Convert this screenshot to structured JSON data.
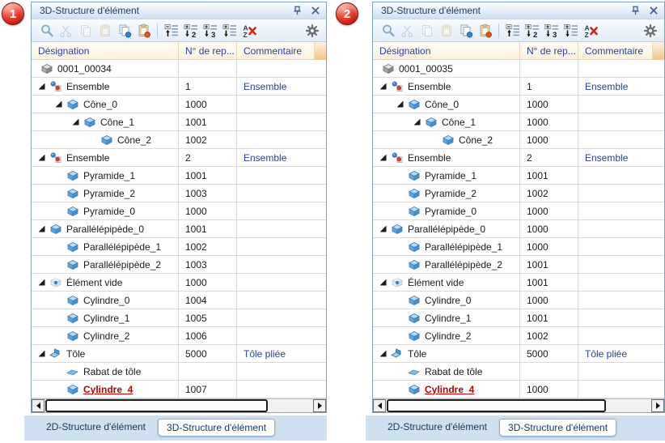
{
  "colors": {
    "panel_border": "#7aa3d0",
    "titlebar_text": "#1d3a5f",
    "header_text": "#2b3f9e",
    "comment_text": "#2b3f9e",
    "row_text": "#1a1a1a",
    "alert_red": "#c00000",
    "badge_red": "#cf1d12",
    "tab_strip": "#cfe0f0",
    "tab_text": "#17365d",
    "header_filler": "#f6c489"
  },
  "toolbar": {
    "icons": [
      {
        "name": "search",
        "disabled": false
      },
      {
        "name": "cut",
        "disabled": true
      },
      {
        "name": "copy",
        "disabled": true
      },
      {
        "name": "paste",
        "disabled": true
      },
      {
        "name": "copy-with-id",
        "disabled": false
      },
      {
        "name": "paste-with-id",
        "disabled": false
      },
      {
        "name": "separator"
      },
      {
        "name": "collapse-structure",
        "disabled": false
      },
      {
        "name": "expand-to-level-2",
        "disabled": false
      },
      {
        "name": "expand-to-level-3",
        "disabled": false
      },
      {
        "name": "expand-all-levels",
        "disabled": false
      },
      {
        "name": "remove-sorting",
        "disabled": false
      }
    ],
    "settings_icon": "settings-gear"
  },
  "panels": [
    {
      "badge": "1",
      "title": "3D-Structure d'élément",
      "columns": [
        "Désignation",
        "N° de rep...",
        "Commentaire"
      ],
      "rows": [
        {
          "name": "0001_00034",
          "num": "",
          "comment": "",
          "depth": 0,
          "expander": false,
          "icon": "root-part"
        },
        {
          "name": "Ensemble",
          "num": "1",
          "comment": "Ensemble",
          "depth": 1,
          "expander": true,
          "icon": "assembly"
        },
        {
          "name": "Cône_0",
          "num": "1000",
          "comment": "",
          "depth": 2,
          "expander": true,
          "icon": "solid"
        },
        {
          "name": "Cône_1",
          "num": "1001",
          "comment": "",
          "depth": 3,
          "expander": true,
          "icon": "solid"
        },
        {
          "name": "Cône_2",
          "num": "1002",
          "comment": "",
          "depth": 4,
          "expander": false,
          "icon": "solid"
        },
        {
          "name": "Ensemble",
          "num": "2",
          "comment": "Ensemble",
          "depth": 1,
          "expander": true,
          "icon": "assembly"
        },
        {
          "name": "Pyramide_1",
          "num": "1001",
          "comment": "",
          "depth": 2,
          "expander": false,
          "icon": "solid"
        },
        {
          "name": "Pyramide_2",
          "num": "1003",
          "comment": "",
          "depth": 2,
          "expander": false,
          "icon": "solid"
        },
        {
          "name": "Pyramide_0",
          "num": "1000",
          "comment": "",
          "depth": 2,
          "expander": false,
          "icon": "solid"
        },
        {
          "name": "Parallélépipède_0",
          "num": "1001",
          "comment": "",
          "depth": 1,
          "expander": true,
          "icon": "solid"
        },
        {
          "name": "Parallélépipède_1",
          "num": "1002",
          "comment": "",
          "depth": 2,
          "expander": false,
          "icon": "solid"
        },
        {
          "name": "Parallélépipède_2",
          "num": "1003",
          "comment": "",
          "depth": 2,
          "expander": false,
          "icon": "solid"
        },
        {
          "name": "Élément vide",
          "num": "1000",
          "comment": "",
          "depth": 1,
          "expander": true,
          "icon": "empty-element"
        },
        {
          "name": "Cylindre_0",
          "num": "1004",
          "comment": "",
          "depth": 2,
          "expander": false,
          "icon": "solid"
        },
        {
          "name": "Cylindre_1",
          "num": "1005",
          "comment": "",
          "depth": 2,
          "expander": false,
          "icon": "solid"
        },
        {
          "name": "Cylindre_2",
          "num": "1006",
          "comment": "",
          "depth": 2,
          "expander": false,
          "icon": "solid"
        },
        {
          "name": "Tôle",
          "num": "5000",
          "comment": "Tôle pliée",
          "depth": 1,
          "expander": true,
          "icon": "sheet-metal"
        },
        {
          "name": "Rabat de tôle",
          "num": "",
          "comment": "",
          "depth": 2,
          "expander": false,
          "icon": "sheet-flange"
        },
        {
          "name": "Cylindre_4",
          "num": "1007",
          "comment": "",
          "depth": 2,
          "expander": false,
          "icon": "solid",
          "red": true
        }
      ],
      "tabs": [
        {
          "label": "2D-Structure d'élément",
          "active": false
        },
        {
          "label": "3D-Structure d'élément",
          "active": true
        }
      ]
    },
    {
      "badge": "2",
      "title": "3D-Structure d'élément",
      "columns": [
        "Désignation",
        "N° de rep...",
        "Commentaire"
      ],
      "rows": [
        {
          "name": "0001_00035",
          "num": "",
          "comment": "",
          "depth": 0,
          "expander": false,
          "icon": "root-part"
        },
        {
          "name": "Ensemble",
          "num": "1",
          "comment": "Ensemble",
          "depth": 1,
          "expander": true,
          "icon": "assembly"
        },
        {
          "name": "Cône_0",
          "num": "1000",
          "comment": "",
          "depth": 2,
          "expander": true,
          "icon": "solid"
        },
        {
          "name": "Cône_1",
          "num": "1000",
          "comment": "",
          "depth": 3,
          "expander": true,
          "icon": "solid"
        },
        {
          "name": "Cône_2",
          "num": "1000",
          "comment": "",
          "depth": 4,
          "expander": false,
          "icon": "solid"
        },
        {
          "name": "Ensemble",
          "num": "2",
          "comment": "Ensemble",
          "depth": 1,
          "expander": true,
          "icon": "assembly"
        },
        {
          "name": "Pyramide_1",
          "num": "1001",
          "comment": "",
          "depth": 2,
          "expander": false,
          "icon": "solid"
        },
        {
          "name": "Pyramide_2",
          "num": "1002",
          "comment": "",
          "depth": 2,
          "expander": false,
          "icon": "solid"
        },
        {
          "name": "Pyramide_0",
          "num": "1000",
          "comment": "",
          "depth": 2,
          "expander": false,
          "icon": "solid"
        },
        {
          "name": "Parallélépipède_0",
          "num": "1000",
          "comment": "",
          "depth": 1,
          "expander": true,
          "icon": "solid"
        },
        {
          "name": "Parallélépipède_1",
          "num": "1000",
          "comment": "",
          "depth": 2,
          "expander": false,
          "icon": "solid"
        },
        {
          "name": "Parallélépipède_2",
          "num": "1001",
          "comment": "",
          "depth": 2,
          "expander": false,
          "icon": "solid"
        },
        {
          "name": "Élément vide",
          "num": "1001",
          "comment": "",
          "depth": 1,
          "expander": true,
          "icon": "empty-element"
        },
        {
          "name": "Cylindre_0",
          "num": "1000",
          "comment": "",
          "depth": 2,
          "expander": false,
          "icon": "solid"
        },
        {
          "name": "Cylindre_1",
          "num": "1001",
          "comment": "",
          "depth": 2,
          "expander": false,
          "icon": "solid"
        },
        {
          "name": "Cylindre_2",
          "num": "1002",
          "comment": "",
          "depth": 2,
          "expander": false,
          "icon": "solid"
        },
        {
          "name": "Tôle",
          "num": "5000",
          "comment": "Tôle pliée",
          "depth": 1,
          "expander": true,
          "icon": "sheet-metal"
        },
        {
          "name": "Rabat de tôle",
          "num": "",
          "comment": "",
          "depth": 2,
          "expander": false,
          "icon": "sheet-flange"
        },
        {
          "name": "Cylindre_4",
          "num": "1000",
          "comment": "",
          "depth": 2,
          "expander": false,
          "icon": "solid",
          "red": true
        }
      ],
      "tabs": [
        {
          "label": "2D-Structure d'élément",
          "active": false
        },
        {
          "label": "3D-Structure d'élément",
          "active": true
        }
      ]
    }
  ]
}
